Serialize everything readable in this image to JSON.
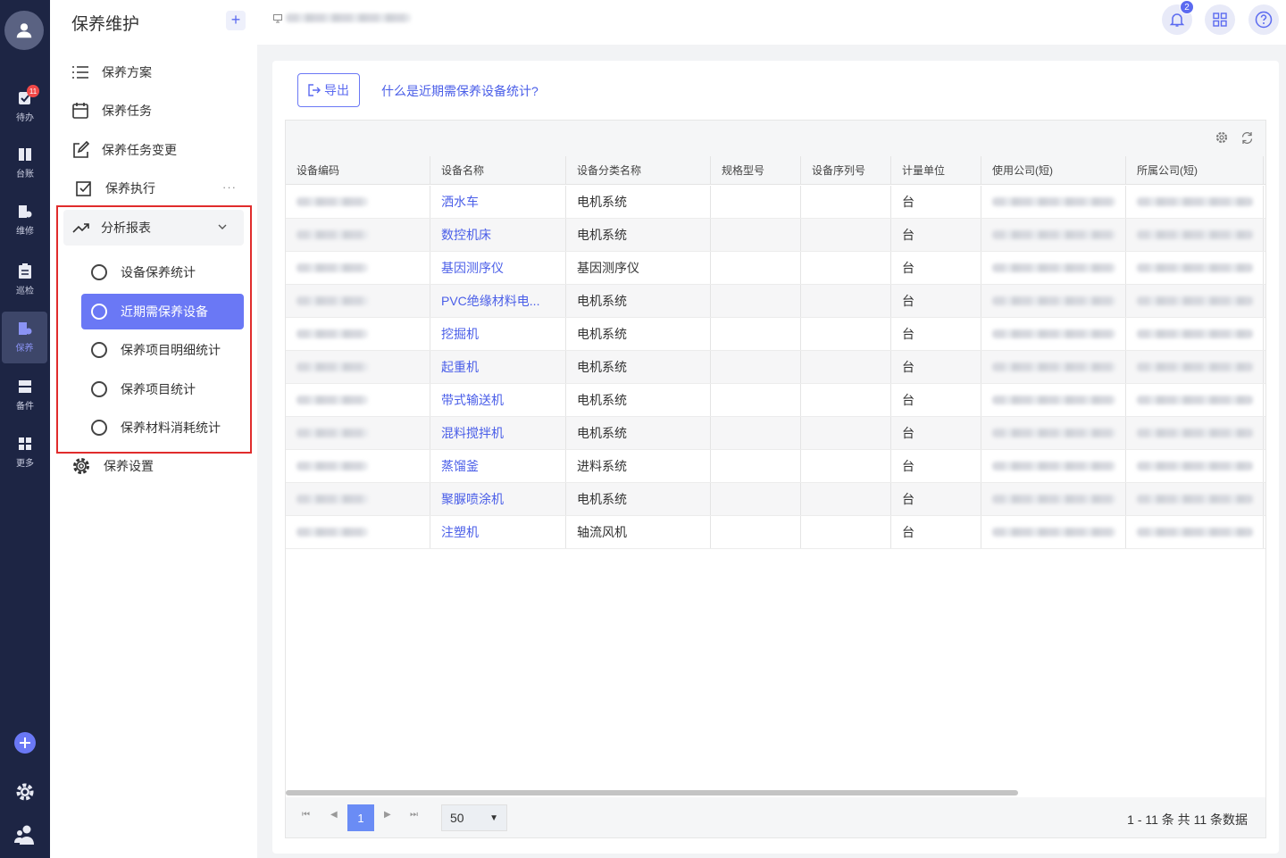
{
  "rail": {
    "items": [
      {
        "label": "待办",
        "badge": "11"
      },
      {
        "label": "台账"
      },
      {
        "label": "维修"
      },
      {
        "label": "巡检"
      },
      {
        "label": "保养"
      },
      {
        "label": "备件"
      },
      {
        "label": "更多"
      }
    ]
  },
  "sidebar": {
    "title": "保养维护",
    "plus": "+",
    "items": [
      "保养方案",
      "保养任务",
      "保养任务变更",
      "保养执行"
    ],
    "dots": "···",
    "group_label": "分析报表",
    "sub_items": [
      "设备保养统计",
      "近期需保养设备",
      "保养项目明细统计",
      "保养项目统计",
      "保养材料消耗统计"
    ],
    "settings_label": "保养设置"
  },
  "topbar": {
    "notification_count": "2"
  },
  "main": {
    "export_label": "导出",
    "help_link": "什么是近期需保养设备统计?"
  },
  "table": {
    "columns": [
      "设备编码",
      "设备名称",
      "设备分类名称",
      "规格型号",
      "设备序列号",
      "计量单位",
      "使用公司(短)",
      "所属公司(短)"
    ],
    "rows": [
      {
        "name": "洒水车",
        "category": "电机系统",
        "unit": "台"
      },
      {
        "name": "数控机床",
        "category": "电机系统",
        "unit": "台"
      },
      {
        "name": "基因测序仪",
        "category": "基因测序仪",
        "unit": "台"
      },
      {
        "name": "PVC绝缘材料电...",
        "category": "电机系统",
        "unit": "台"
      },
      {
        "name": "挖掘机",
        "category": "电机系统",
        "unit": "台"
      },
      {
        "name": "起重机",
        "category": "电机系统",
        "unit": "台"
      },
      {
        "name": "带式输送机",
        "category": "电机系统",
        "unit": "台"
      },
      {
        "name": "混料搅拌机",
        "category": "电机系统",
        "unit": "台"
      },
      {
        "name": "蒸馏釜",
        "category": "进料系统",
        "unit": "台"
      },
      {
        "name": "聚脲喷涂机",
        "category": "电机系统",
        "unit": "台"
      },
      {
        "name": "注塑机",
        "category": "轴流风机",
        "unit": "台"
      }
    ]
  },
  "pager": {
    "first": "⏮",
    "prev": "◀",
    "next": "▶",
    "last": "⏭",
    "page": "1",
    "page_size": "50",
    "size_arrow": "▼",
    "info": "1 - 11 条   共 11 条数据"
  }
}
